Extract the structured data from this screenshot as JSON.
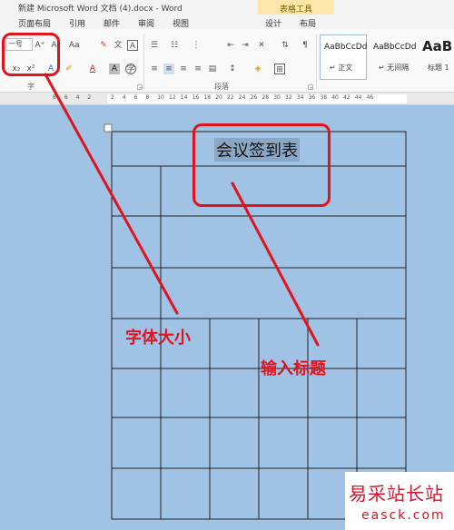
{
  "window": {
    "title": "新建 Microsoft Word 文档 (4).docx - Word",
    "contextual_tab_group": "表格工具"
  },
  "tabs": [
    {
      "label": "页面布局"
    },
    {
      "label": "引用"
    },
    {
      "label": "邮件"
    },
    {
      "label": "审阅"
    },
    {
      "label": "视图"
    },
    {
      "label": "设计"
    },
    {
      "label": "布局"
    }
  ],
  "ribbon": {
    "font_size_value": "一号",
    "font_group_label": "字",
    "paragraph_group_label": "段落",
    "font_case_label": "Aa",
    "styles": [
      {
        "sample": "AaBbCcDd",
        "name": "↵ 正文"
      },
      {
        "sample": "AaBbCcDd",
        "name": "↵ 无间隔"
      },
      {
        "sample": "AaBl",
        "name": "标题 1"
      }
    ]
  },
  "ruler": {
    "ticks": [
      "8",
      "6",
      "4",
      "2",
      "",
      "2",
      "4",
      "6",
      "8",
      "10",
      "12",
      "14",
      "16",
      "18",
      "20",
      "22",
      "24",
      "26",
      "28",
      "30",
      "32",
      "34",
      "36",
      "38",
      "40",
      "42",
      "44",
      "46"
    ]
  },
  "document": {
    "table_title": "会议签到表"
  },
  "annotations": {
    "font_size_label": "字体大小",
    "input_title_label": "输入标题"
  },
  "watermark": {
    "text": "易采站长站",
    "url": "easck.com"
  },
  "colors": {
    "annotation_red": "#e0141c",
    "page_background": "#9fc2e5",
    "table_lines": "#222222"
  }
}
